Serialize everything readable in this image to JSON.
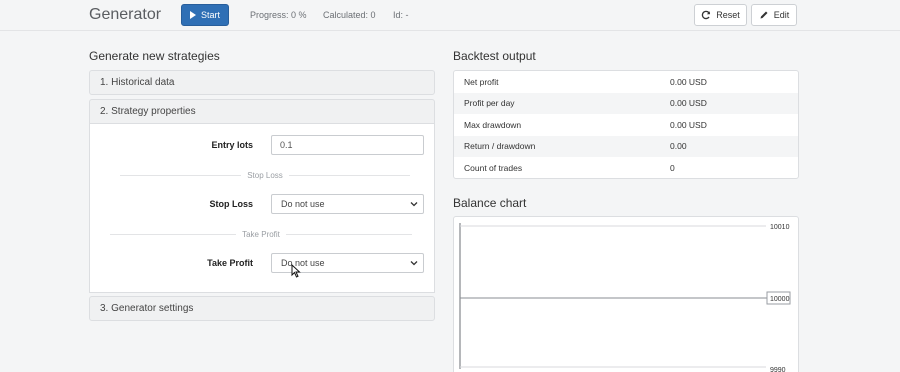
{
  "header": {
    "title": "Generator",
    "start_label": "Start",
    "progress": "Progress: 0 %",
    "calculated": "Calculated: 0",
    "id": "Id: -",
    "reset_label": "Reset",
    "edit_label": "Edit"
  },
  "generate": {
    "title": "Generate new strategies",
    "sections": {
      "historical": "1. Historical data",
      "strategy": "2. Strategy properties",
      "generator": "3. Generator settings"
    },
    "entry_lots_label": "Entry lots",
    "entry_lots_value": "0.1",
    "stop_loss_divider": "Stop Loss",
    "stop_loss_label": "Stop Loss",
    "stop_loss_value": "Do not use",
    "take_profit_divider": "Take Profit",
    "take_profit_label": "Take Profit",
    "take_profit_value": "Do not use"
  },
  "backtest": {
    "title": "Backtest output",
    "rows": [
      {
        "key": "Net profit",
        "value": "0.00 USD"
      },
      {
        "key": "Profit per day",
        "value": "0.00 USD"
      },
      {
        "key": "Max drawdown",
        "value": "0.00 USD"
      },
      {
        "key": "Return / drawdown",
        "value": "0.00"
      },
      {
        "key": "Count of trades",
        "value": "0"
      }
    ]
  },
  "balance": {
    "title": "Balance chart",
    "ticks": [
      "10010",
      "10000",
      "9990"
    ]
  },
  "colors": {
    "accent": "#2f6fb5"
  }
}
